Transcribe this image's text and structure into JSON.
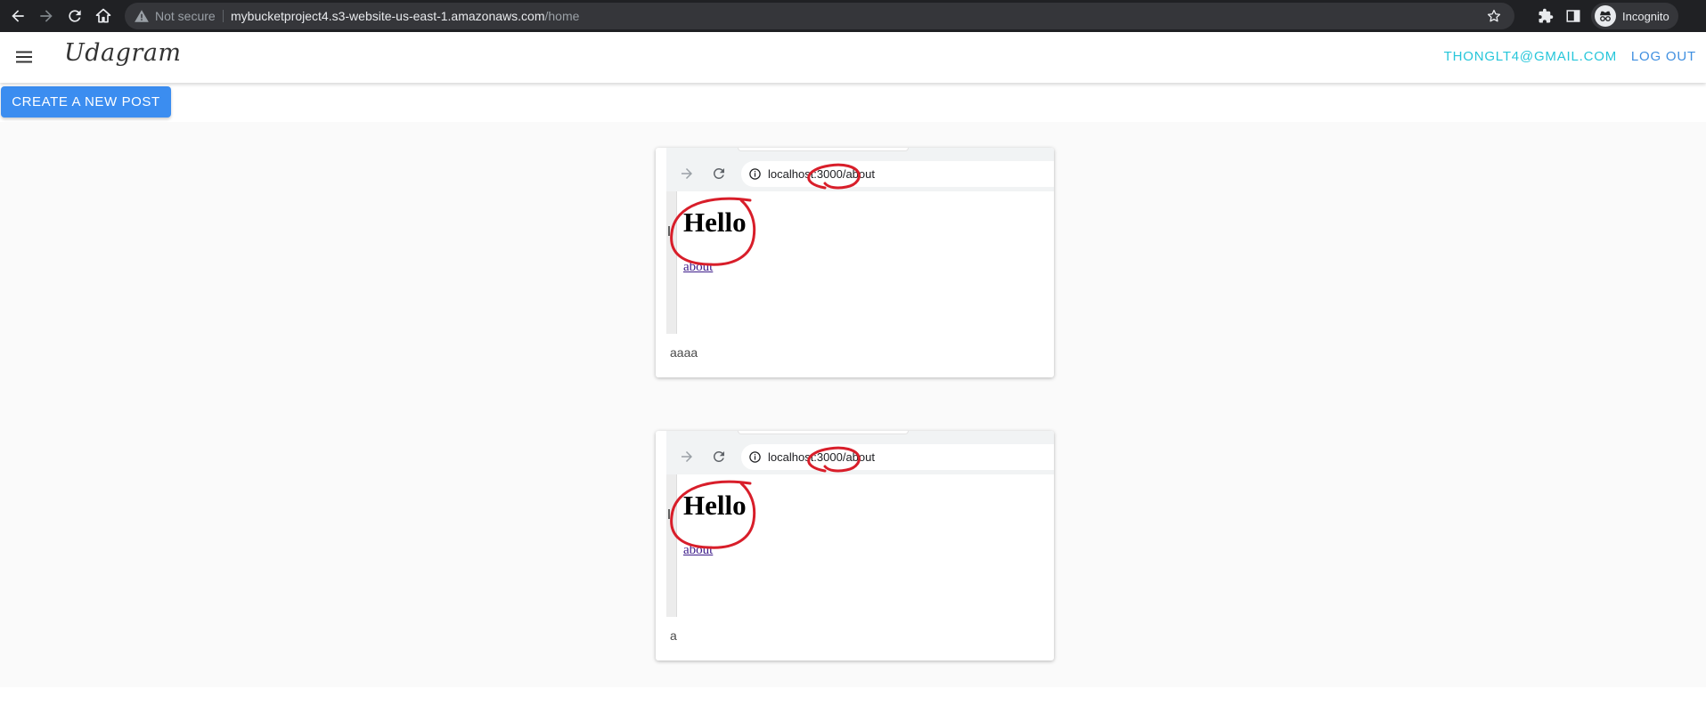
{
  "browser": {
    "security_label": "Not secure",
    "url_host": "mybucketproject4.s3-website-us-east-1.amazonaws.com",
    "url_path": "/home",
    "profile_label": "Incognito"
  },
  "header": {
    "brand": "Udagram",
    "user_email": "THONGLT4@GMAIL.COM",
    "logout_label": "LOG OUT"
  },
  "actions": {
    "create_post_label": "CREATE A NEW POST"
  },
  "posts": [
    {
      "screenshot": {
        "url": "localhost:3000/about",
        "heading": "Hello",
        "link": "about"
      },
      "caption": "aaaa"
    },
    {
      "screenshot": {
        "url": "localhost:3000/about",
        "heading": "Hello",
        "link": "about"
      },
      "caption": "a"
    }
  ],
  "colors": {
    "chrome_bg": "#202124",
    "brand_accent": "#3b8df0",
    "email_color": "#26c6da",
    "annotation_red": "#d81e2a"
  }
}
